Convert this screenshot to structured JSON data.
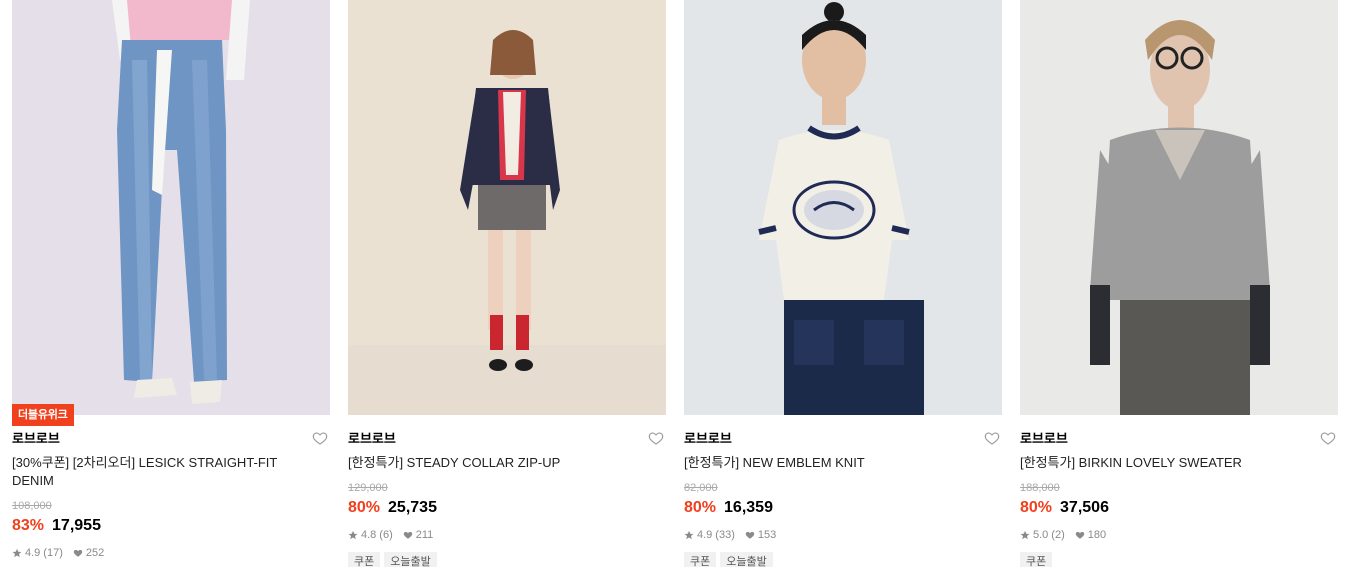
{
  "products": [
    {
      "badge": "더블유위크",
      "brand": "로브로브",
      "title": "[30%쿠폰] [2차리오더] LESICK STRAIGHT-FIT DENIM",
      "original_price": "108,000",
      "discount": "83%",
      "price": "17,955",
      "rating": "4.9",
      "reviews": "(17)",
      "likes": "252",
      "tags": []
    },
    {
      "badge": "",
      "brand": "로브로브",
      "title": "[한정특가] STEADY COLLAR ZIP-UP",
      "original_price": "129,000",
      "discount": "80%",
      "price": "25,735",
      "rating": "4.8",
      "reviews": "(6)",
      "likes": "211",
      "tags": [
        "쿠폰",
        "오늘출발"
      ]
    },
    {
      "badge": "",
      "brand": "로브로브",
      "title": "[한정특가] NEW EMBLEM KNIT",
      "original_price": "82,000",
      "discount": "80%",
      "price": "16,359",
      "rating": "4.9",
      "reviews": "(33)",
      "likes": "153",
      "tags": [
        "쿠폰",
        "오늘출발"
      ]
    },
    {
      "badge": "",
      "brand": "로브로브",
      "title": "[한정특가] BIRKIN LOVELY SWEATER",
      "original_price": "188,000",
      "discount": "80%",
      "price": "37,506",
      "rating": "5.0",
      "reviews": "(2)",
      "likes": "180",
      "tags": [
        "쿠폰"
      ]
    }
  ],
  "colors": {
    "discount": "#f0401d",
    "badge_bg": "#f0401d",
    "muted": "#8a8a8a",
    "tag_bg": "#f1f1f1"
  },
  "icons": {
    "like": "heart-outline-icon",
    "rating": "star-icon",
    "likes_count": "heart-filled-icon"
  }
}
